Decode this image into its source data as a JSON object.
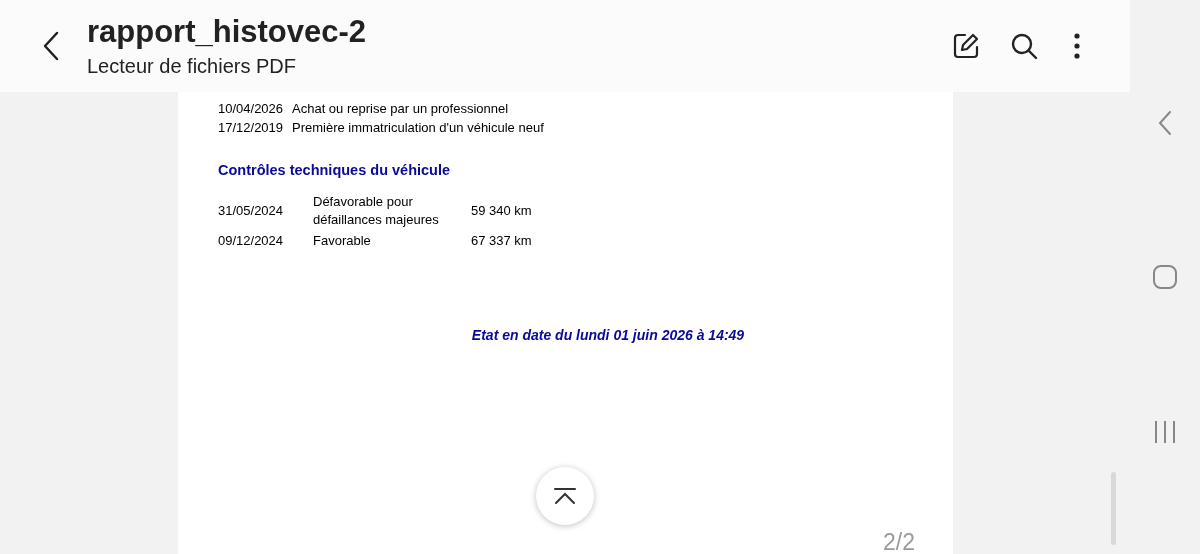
{
  "header": {
    "title": "rapport_histovec-2",
    "subtitle": "Lecteur de fichiers PDF"
  },
  "history": [
    {
      "date": "10/04/2026",
      "event": "Achat ou reprise par un professionnel"
    },
    {
      "date": "17/12/2019",
      "event": "Première immatriculation d'un véhicule neuf"
    }
  ],
  "inspections": {
    "heading": "Contrôles techniques du véhicule",
    "rows": [
      {
        "date": "31/05/2024",
        "result": "Défavorable pour défaillances majeures",
        "mileage": "59 340 km"
      },
      {
        "date": "09/12/2024",
        "result": "Favorable",
        "mileage": "67 337 km"
      }
    ]
  },
  "footer_note": "Etat en date du lundi 01 juin 2026 à 14:49",
  "page_indicator": "2/2"
}
